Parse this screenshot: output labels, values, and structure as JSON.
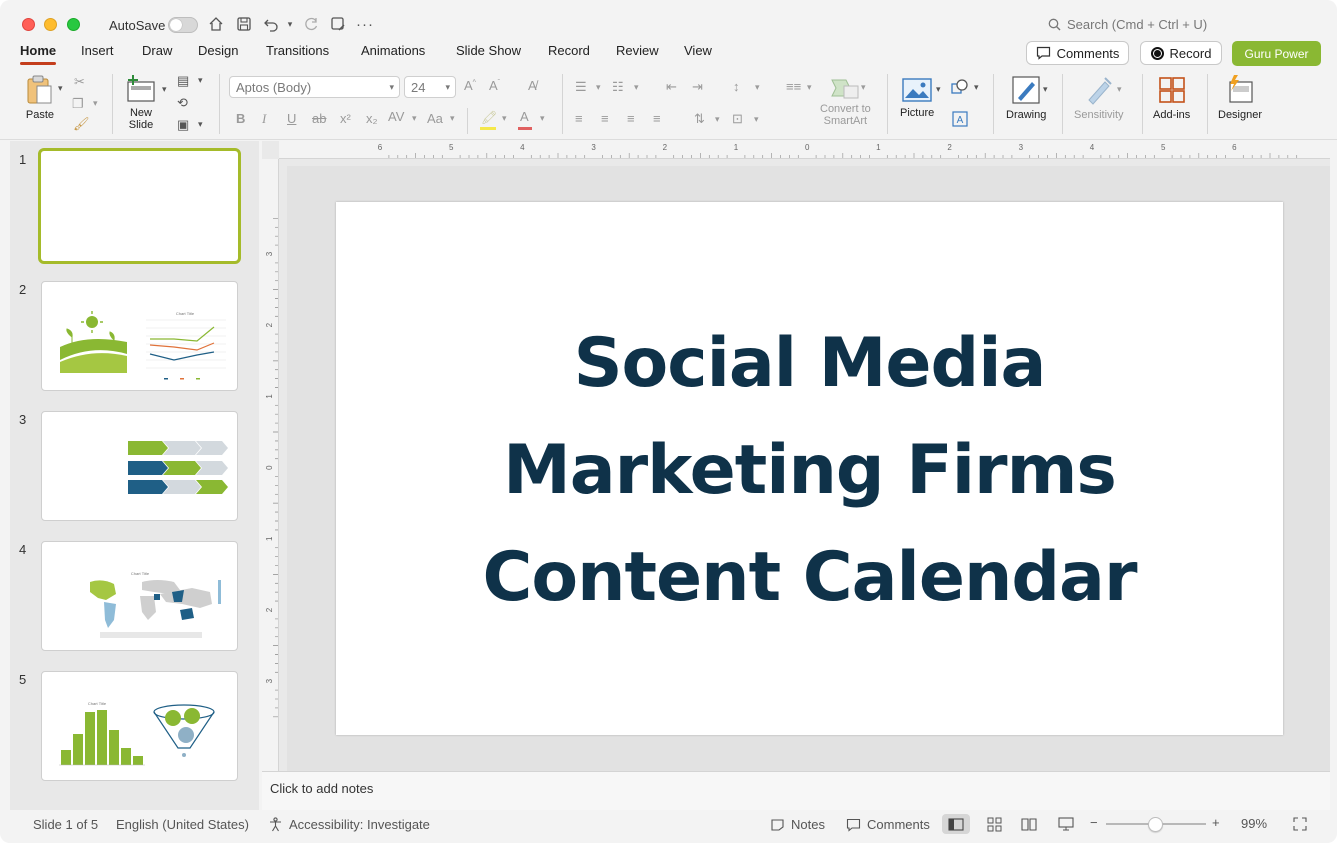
{
  "titlebar": {
    "autosave_label": "AutoSave",
    "search_placeholder": "Search (Cmd + Ctrl + U)"
  },
  "tabs": [
    {
      "label": "Home",
      "active": true
    },
    {
      "label": "Insert"
    },
    {
      "label": "Draw"
    },
    {
      "label": "Design"
    },
    {
      "label": "Transitions"
    },
    {
      "label": "Animations"
    },
    {
      "label": "Slide Show"
    },
    {
      "label": "Record"
    },
    {
      "label": "Review"
    },
    {
      "label": "View"
    }
  ],
  "header_buttons": {
    "comments": "Comments",
    "record": "Record",
    "guru": "Guru Power"
  },
  "ribbon": {
    "paste": "Paste",
    "new_slide_line1": "New",
    "new_slide_line2": "Slide",
    "font_name": "Aptos (Body)",
    "font_size": "24",
    "convert_line1": "Convert to",
    "convert_line2": "SmartArt",
    "picture": "Picture",
    "drawing": "Drawing",
    "sensitivity": "Sensitivity",
    "addins": "Add-ins",
    "designer": "Designer"
  },
  "slides": {
    "numbers": [
      "1",
      "2",
      "3",
      "4",
      "5"
    ],
    "thumb2_chart_title": "Chart Title",
    "thumb4_chart_title": "Chart Title",
    "thumb5_chart_title": "Chart Title"
  },
  "main_slide": {
    "title_line1": "Social Media",
    "title_line2": "Marketing Firms",
    "title_line3": "Content Calendar"
  },
  "notes_placeholder": "Click to add notes",
  "status": {
    "slide_info": "Slide 1 of 5",
    "language": "English (United States)",
    "accessibility": "Accessibility: Investigate",
    "notes": "Notes",
    "comments": "Comments",
    "zoom": "99%"
  },
  "ruler": {
    "h_ticks": [
      "6",
      "5",
      "4",
      "3",
      "2",
      "1",
      "0",
      "1",
      "2",
      "3",
      "4",
      "5",
      "6"
    ],
    "v_ticks": [
      "3",
      "2",
      "1",
      "0",
      "1",
      "2",
      "3"
    ]
  },
  "colors": {
    "accent_green": "#8ab833",
    "title_navy": "#0f3249",
    "tab_underline": "#c43e1c",
    "thumb_blue": "#1f5f86"
  }
}
